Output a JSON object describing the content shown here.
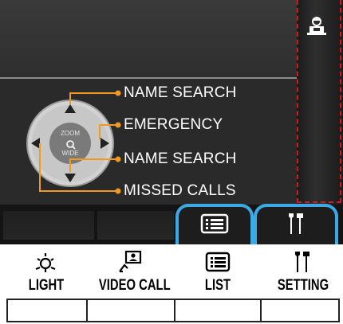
{
  "screen": {
    "labels": {
      "name_search_top": "NAME SEARCH",
      "emergency": "EMERGENCY",
      "name_search_bottom": "NAME SEARCH",
      "missed_calls": "MISSED CALLS"
    },
    "dpad": {
      "zoom_top": "ZOOM",
      "zoom_bottom": "WIDE"
    },
    "right_panel_icon": "monitoring-icon",
    "tabs": [
      {
        "icon": "list-icon"
      },
      {
        "icon": "settings-icon"
      }
    ]
  },
  "buttons": {
    "light": {
      "label": "LIGHT",
      "icon": "light-icon"
    },
    "video_call": {
      "label": "VIDEO CALL",
      "icon": "video-call-icon"
    },
    "list": {
      "label": "LIST",
      "icon": "list-icon"
    },
    "setting": {
      "label": "SETTING",
      "icon": "setting-icon"
    }
  },
  "colors": {
    "accent": "#f29a1e",
    "tab_border": "#3aa9e6",
    "marker": "#d21b1b",
    "screen_bg": "#2d2d2d"
  }
}
